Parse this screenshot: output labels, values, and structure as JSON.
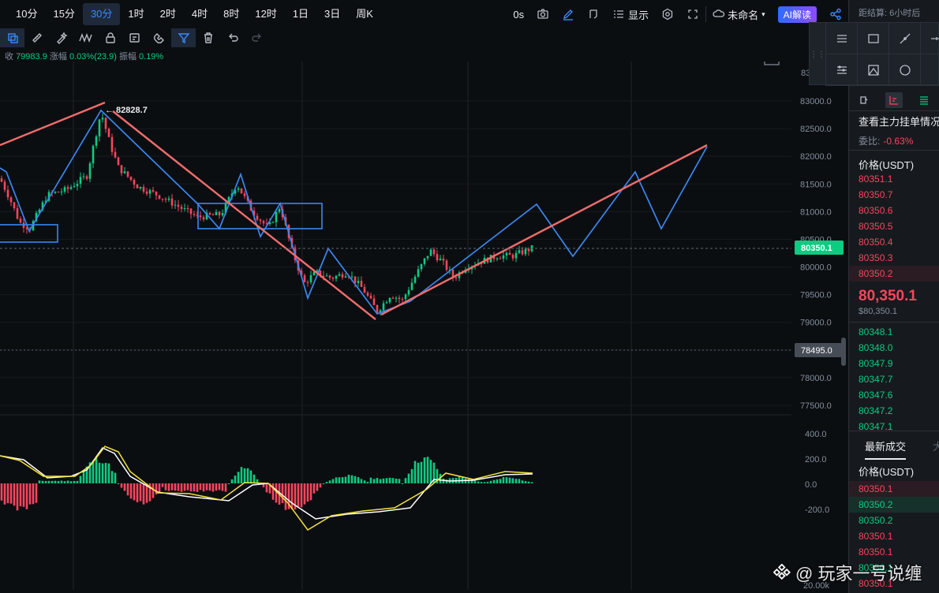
{
  "intervals": [
    "10分",
    "15分",
    "30分",
    "1时",
    "2时",
    "4时",
    "8时",
    "12时",
    "1日",
    "3日",
    "周K"
  ],
  "active_interval": "30分",
  "toolbar": {
    "timer": "0s",
    "display_label": "显示",
    "layout_name": "未命名",
    "ai_label": "AI解读"
  },
  "stats": {
    "close_label": "收",
    "close_value": "79983.9",
    "change_label": "涨幅",
    "change_value": "0.03%(23.9)",
    "amp_label": "振幅",
    "amp_value": "0.19%"
  },
  "colors": {
    "up": "#0ecb81",
    "down": "#f6465d",
    "trend": "#f26c6c",
    "wave": "#3a86f0",
    "accent": "#3b89ff"
  },
  "chart_data": {
    "type": "candlestick",
    "price_axis_ticks": [
      "83000.0",
      "82500.0",
      "82000.0",
      "81500.0",
      "81000.0",
      "80500.0",
      "80000.0",
      "79500.0",
      "79000.0",
      "78500.0",
      "78000.0",
      "77500.0"
    ],
    "price_axis_partial_top": "83",
    "peak_label": "82828.7",
    "current_price_label": "80350.1",
    "crosshair_label": "78495.0",
    "macd_ticks": [
      "400.0",
      "200.0",
      "0.0",
      "-200.0"
    ],
    "volume_tick": "20.00k",
    "ylim": [
      77300,
      83300
    ]
  },
  "orderbook": {
    "countdown": "距结算: 6小时后",
    "title": "查看主力挂单情况",
    "ratio_label": "委比:",
    "ratio_value": "-0.63%",
    "price_header": "价格(USDT)",
    "asks": [
      "80351.1",
      "80350.7",
      "80350.6",
      "80350.5",
      "80350.4",
      "80350.3",
      "80350.2"
    ],
    "mid_price": "80,350.1",
    "mid_sub": "$80,350.1",
    "bids": [
      "80348.1",
      "80348.0",
      "80347.9",
      "80347.7",
      "80347.6",
      "80347.2",
      "80347.1"
    ]
  },
  "trades": {
    "tab_label": "最新成交",
    "tab2_label": "大",
    "price_header": "价格(USDT)",
    "rows": [
      {
        "price": "80350.1",
        "side": "ask"
      },
      {
        "price": "80350.2",
        "side": "bid"
      },
      {
        "price": "80350.2",
        "side": "bid"
      },
      {
        "price": "80350.1",
        "side": "ask"
      },
      {
        "price": "80350.1",
        "side": "ask"
      },
      {
        "price": "80350.1",
        "side": "bid"
      },
      {
        "price": "80350.1",
        "side": "ask"
      }
    ]
  },
  "watermark": "@ 玩家一号说缠"
}
